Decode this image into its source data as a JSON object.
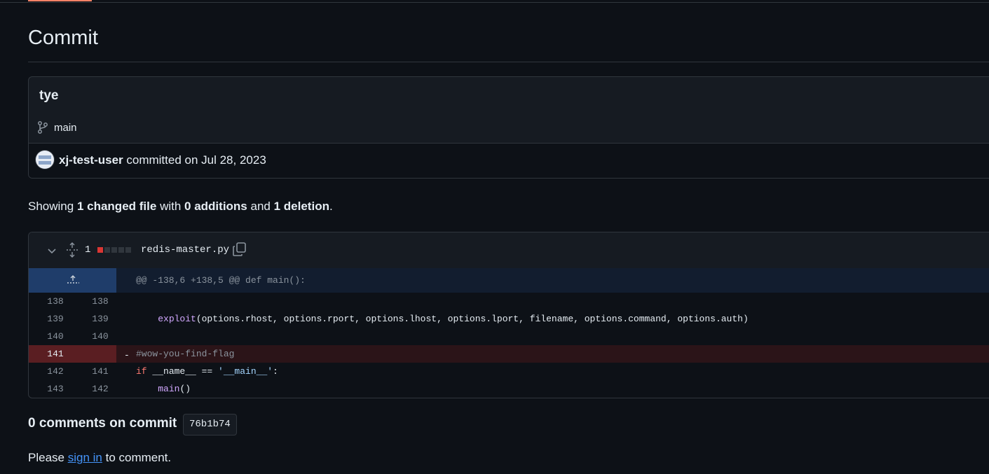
{
  "page": {
    "title": "Commit"
  },
  "commit": {
    "message": "tye",
    "branch": "main",
    "author": "xj-test-user",
    "committed_text": "committed on Jul 28, 2023"
  },
  "summary": {
    "showing": "Showing",
    "files_changed": "1 changed file",
    "with": "with",
    "additions": "0 additions",
    "and": "and",
    "deletions": "1 deletion",
    "end": "."
  },
  "file": {
    "change_count": "1",
    "name": "redis-master.py",
    "diffstat": [
      "deleted",
      "neutral",
      "neutral",
      "neutral",
      "neutral"
    ],
    "hunk_header": "@@ -138,6 +138,5 @@ def main():",
    "lines": [
      {
        "old": "138",
        "new": "138",
        "marker": "",
        "code": ""
      },
      {
        "old": "139",
        "new": "139",
        "marker": "",
        "code_pre": "    ",
        "code_fn": "exploit",
        "code_rest": "(options.rhost, options.rport, options.lhost, options.lport, filename, options.command, options.auth)"
      },
      {
        "old": "140",
        "new": "140",
        "marker": "",
        "code": ""
      },
      {
        "old": "141",
        "new": "",
        "marker": "-",
        "code": "#wow-you-find-flag"
      },
      {
        "old": "142",
        "new": "141",
        "marker": "",
        "code_kw": "if",
        "code_mid": " __name__ == ",
        "code_str": "'__main__'",
        "code_end": ":"
      },
      {
        "old": "143",
        "new": "142",
        "marker": "",
        "code_pre": "    ",
        "code_fn": "main",
        "code_rest": "()"
      }
    ]
  },
  "comments": {
    "heading": "0 comments on commit",
    "sha": "76b1b74",
    "please": "Please",
    "sign_in": "sign in",
    "to_comment": "to comment."
  }
}
